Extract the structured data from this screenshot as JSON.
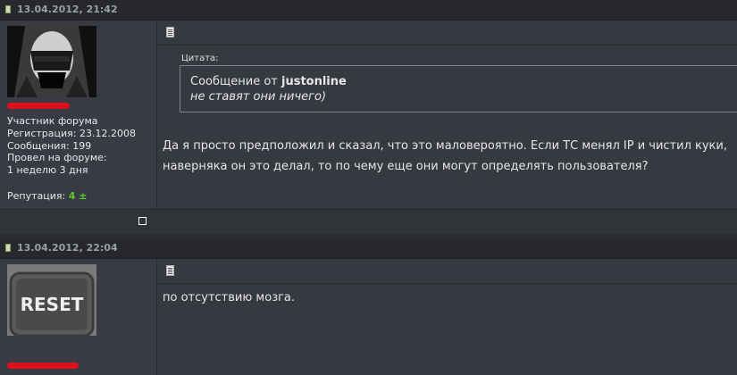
{
  "posts": [
    {
      "date": "13.04.2012, 21:42",
      "user": {
        "role": "Участник форума",
        "registration": "Регистрация: 23.12.2008",
        "messages": "Сообщения: 199",
        "online_label": "Провел на форуме:",
        "online_value": "1 неделю 3 дня",
        "reputation_label": "Репутация:",
        "reputation_value": "4 ±"
      },
      "quote": {
        "label": "Цитата:",
        "author_prefix": "Сообщение от",
        "author": "justonline",
        "text": "не ставят они ничего)"
      },
      "text_lines": [
        "Да я просто предположил и сказал, что это маловероятно. Если ТС менял IP и чистил куки,",
        "наверняка он это делал, то по чему еще они могут определять пользователя?"
      ]
    },
    {
      "date": "13.04.2012, 22:04",
      "avatar_text": "RESET",
      "text_lines": [
        "по отсутствию мозга."
      ]
    }
  ],
  "colors": {
    "reputation": "#5ccc2a",
    "redacted": "#e0101a"
  }
}
